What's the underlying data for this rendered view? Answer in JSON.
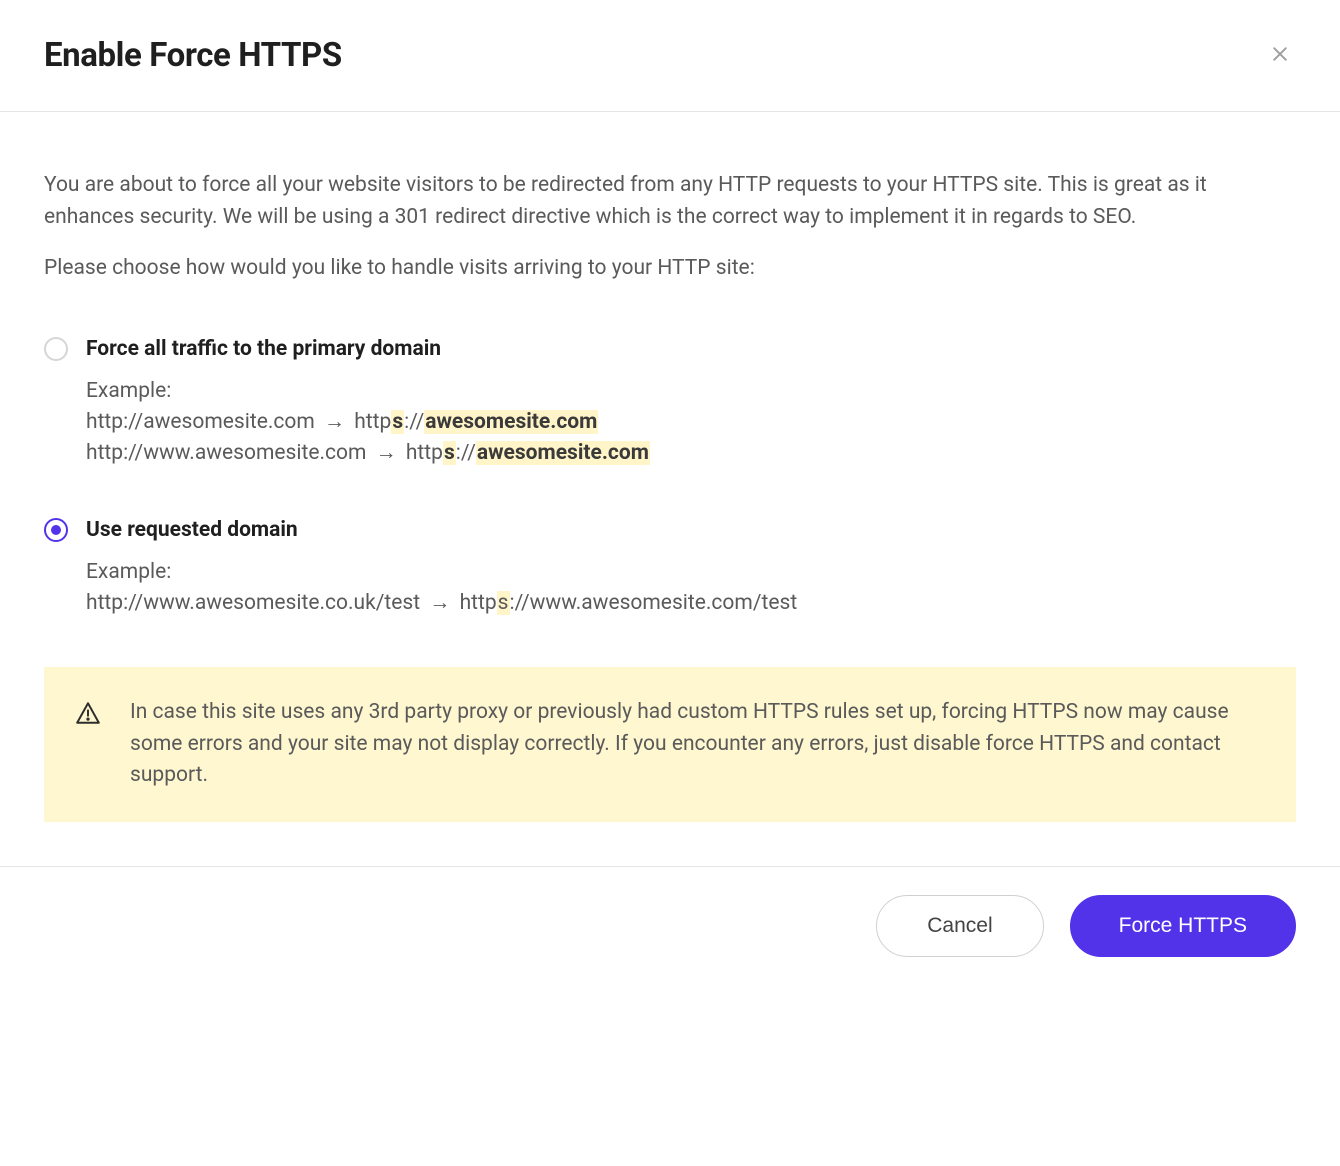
{
  "header": {
    "title": "Enable Force HTTPS"
  },
  "intro": {
    "paragraph": "You are about to force all your website visitors to be redirected from any HTTP requests to your HTTPS site. This is great as it enhances security. We will be using a 301 redirect directive which is the correct way to implement it in regards to SEO.",
    "choose_prompt": "Please choose how would you like to handle visits arriving to your HTTP site:"
  },
  "options": {
    "primary_domain": {
      "label": "Force all traffic to the primary domain",
      "selected": false,
      "example_label": "Example:",
      "line1_from": "http://awesomesite.com",
      "line1_arrow": "→",
      "line1_http_prefix": "http",
      "line1_s": "s",
      "line1_sep": "://",
      "line1_domain": "awesomesite.com",
      "line2_from": "http://www.awesomesite.com",
      "line2_arrow": "→",
      "line2_http_prefix": "http",
      "line2_s": "s",
      "line2_sep": "://",
      "line2_domain": "awesomesite.com"
    },
    "requested_domain": {
      "label": "Use requested domain",
      "selected": true,
      "example_label": "Example:",
      "line1_from": "http://www.awesomesite.co.uk/test",
      "line1_arrow": "→",
      "line1_http_prefix": "http",
      "line1_s": "s",
      "line1_rest": "://www.awesomesite.com/test"
    }
  },
  "warning": {
    "text": "In case this site uses any 3rd party proxy or previously had custom HTTPS rules set up, forcing HTTPS now may cause some errors and your site may not display correctly. If you encounter any errors, just disable force HTTPS and contact support."
  },
  "footer": {
    "cancel_label": "Cancel",
    "confirm_label": "Force HTTPS"
  }
}
